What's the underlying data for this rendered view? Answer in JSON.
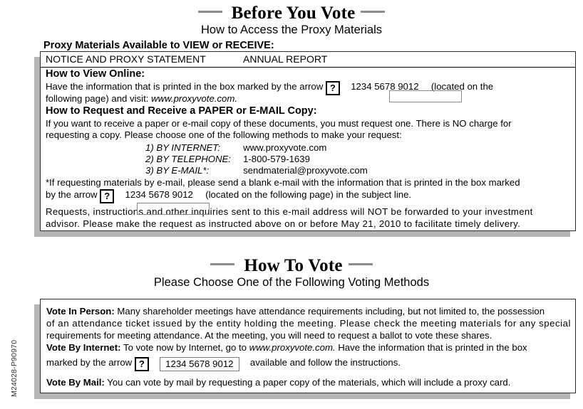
{
  "document": {
    "side_code": "M24028-P90970"
  },
  "section1": {
    "title": "Before You Vote",
    "subtitle": "How to Access the Proxy Materials",
    "lead_heading": "Proxy Materials Available to VIEW or RECEIVE:",
    "doc_types": {
      "left": "NOTICE AND PROXY STATEMENT",
      "right": "ANNUAL REPORT"
    },
    "view_online": {
      "heading": "How to View Online:",
      "line1_pre": "Have the information that is printed in the box marked by the arrow",
      "marker_icon": "?",
      "control_number": "1234 5678 9012",
      "line1_post": "(located on the",
      "line2_pre": "following page) and visit:",
      "line2_url": "www.proxyvote.com."
    },
    "request_copy": {
      "heading": "How to Request and Receive a PAPER or E-MAIL Copy:",
      "line1": "If you want to receive a paper or e-mail copy of these documents, you must request one.  There is NO charge for",
      "line2": "requesting a copy.  Please choose one of the following methods to make your request:",
      "methods": [
        {
          "num": "1)",
          "label": "BY INTERNET:",
          "value": "www.proxyvote.com"
        },
        {
          "num": "2)",
          "label": "BY TELEPHONE:",
          "value": "1-800-579-1639"
        },
        {
          "num": "3)",
          "label": "BY E-MAIL*:",
          "value": "sendmaterial@proxyvote.com"
        }
      ],
      "footnote_line1": "*If requesting materials by e-mail, please send a blank e-mail with the information that is printed in the box marked",
      "footnote_line2_pre": "by the arrow",
      "footnote_marker_icon": "?",
      "footnote_control_number": "1234 5678 9012",
      "footnote_line2_post": "(located on the following page) in the subject line."
    },
    "closing": {
      "line1": "Requests, instructions and other inquiries sent to this e-mail address will NOT be forwarded to your investment",
      "line2": "advisor.  Please make the request as instructed above on or before May 21, 2010 to facilitate timely delivery."
    }
  },
  "section2": {
    "title": "How To Vote",
    "subtitle": "Please Choose One of the Following Voting Methods",
    "vote_in_person": {
      "label": "Vote In Person:",
      "line1": "Many shareholder meetings have attendance requirements including, but not limited to, the possession",
      "line2": "of an attendance ticket issued by the entity holding the meeting.  Please check the meeting materials for any special",
      "line3": "requirements for meeting attendance.  At the meeting, you will need to request a ballot to vote these shares."
    },
    "vote_by_internet": {
      "label": "Vote By Internet:",
      "line1_pre": "To vote now by Internet, go to",
      "line1_url": "www.proxyvote.com.",
      "line1_post": "Have the information that is printed in the box",
      "line2_pre": "marked by the arrow",
      "marker_icon": "?",
      "control_number": "1234 5678 9012",
      "line2_post": "available and follow the instructions."
    },
    "vote_by_mail": {
      "label": "Vote By Mail:",
      "line1": "You can vote by mail by requesting a paper copy of the materials, which will include a proxy card."
    }
  },
  "colors": {
    "text": "#000000",
    "rule": "#8c8c8c",
    "shadow": "#b5b5b5",
    "border": "#2b2b2b"
  }
}
